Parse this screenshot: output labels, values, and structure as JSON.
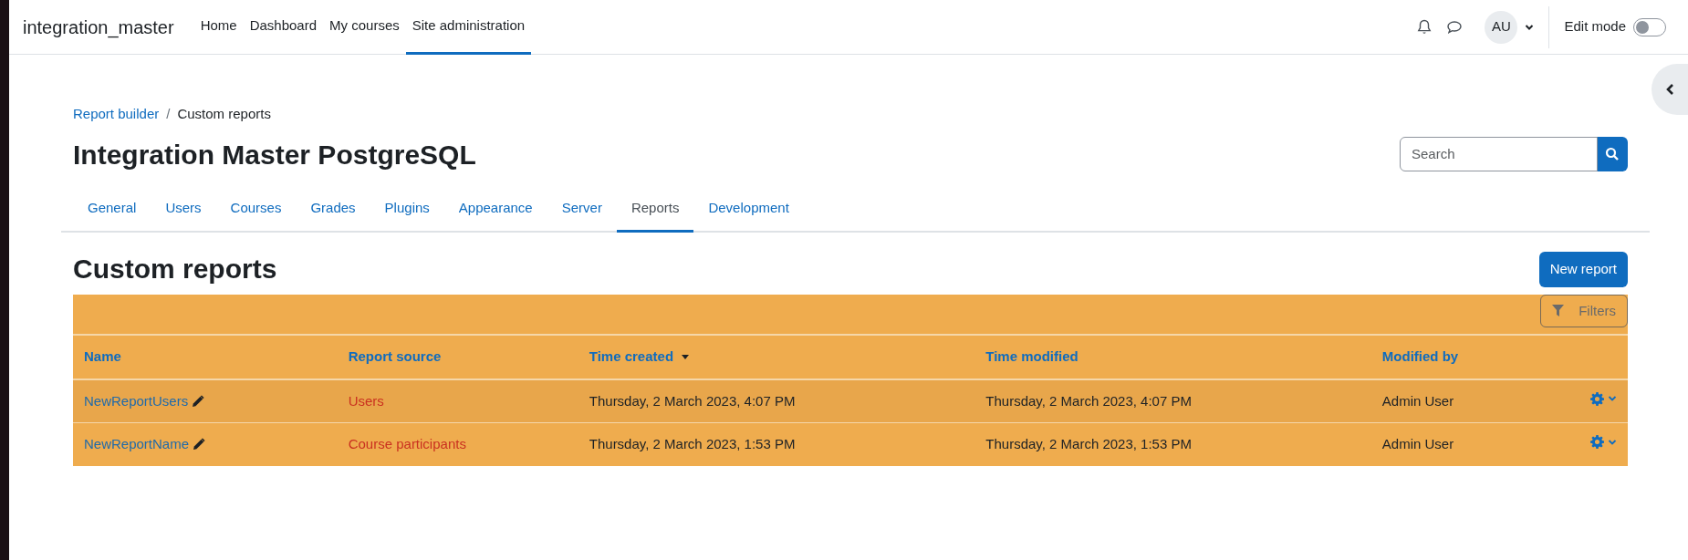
{
  "navbar": {
    "brand": "integration_master",
    "items": [
      {
        "label": "Home",
        "selected": false
      },
      {
        "label": "Dashboard",
        "selected": false
      },
      {
        "label": "My courses",
        "selected": false
      },
      {
        "label": "Site administration",
        "selected": true
      }
    ],
    "avatar": "AU",
    "edit_mode": {
      "label": "Edit mode",
      "on": false
    }
  },
  "breadcrumb": [
    {
      "label": "Report builder",
      "kind": "link"
    },
    {
      "label": "Custom reports",
      "kind": "current"
    }
  ],
  "breadcrumb_separator": "/",
  "page_title": "Integration Master PostgreSQL",
  "search": {
    "placeholder": "Search"
  },
  "tabs": [
    {
      "label": "General",
      "selected": false
    },
    {
      "label": "Users",
      "selected": false
    },
    {
      "label": "Courses",
      "selected": false
    },
    {
      "label": "Grades",
      "selected": false
    },
    {
      "label": "Plugins",
      "selected": false
    },
    {
      "label": "Appearance",
      "selected": false
    },
    {
      "label": "Server",
      "selected": false
    },
    {
      "label": "Reports",
      "selected": true
    },
    {
      "label": "Development",
      "selected": false
    }
  ],
  "section_title": "Custom reports",
  "new_button": "New report",
  "filters_button": "Filters",
  "table": {
    "columns": [
      {
        "label": "Name",
        "sorted": false
      },
      {
        "label": "Report source",
        "sorted": false
      },
      {
        "label": "Time created",
        "sorted": true
      },
      {
        "label": "Time modified",
        "sorted": false
      },
      {
        "label": "Modified by",
        "sorted": false
      }
    ],
    "rows": [
      {
        "name": "NewReportUsers",
        "source": "Users",
        "created": "Thursday, 2 March 2023, 4:07 PM",
        "modified": "Thursday, 2 March 2023, 4:07 PM",
        "modified_by": "Admin User",
        "highlighted": true
      },
      {
        "name": "NewReportName",
        "source": "Course participants",
        "created": "Thursday, 2 March 2023, 1:53 PM",
        "modified": "Thursday, 2 March 2023, 1:53 PM",
        "modified_by": "Admin User",
        "highlighted": false
      }
    ]
  }
}
